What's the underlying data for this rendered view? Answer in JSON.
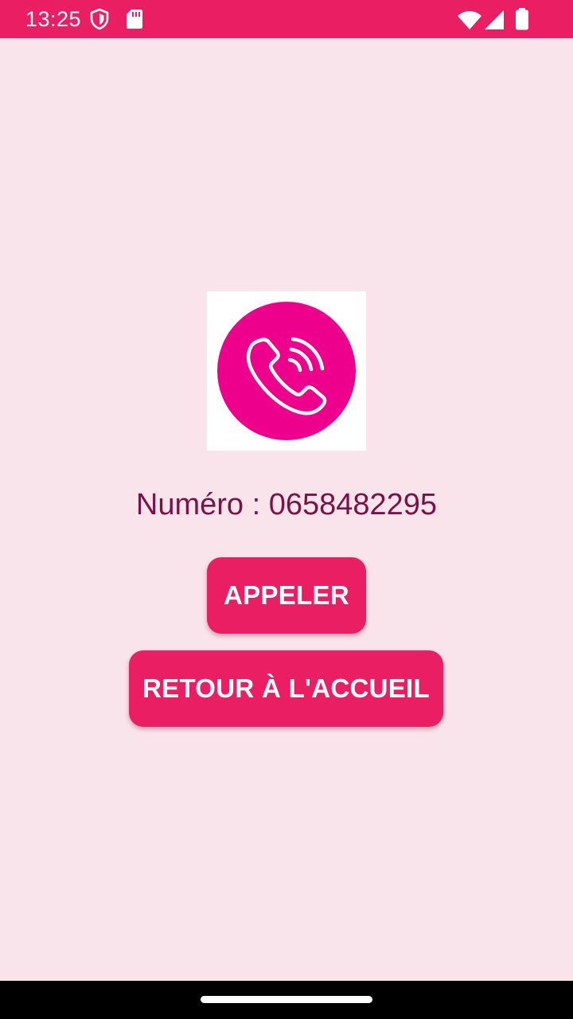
{
  "status_bar": {
    "time": "13:25",
    "color": "#e91e63",
    "icons": [
      "shield-icon",
      "sd-card-icon",
      "wifi-icon",
      "cell-signal-icon",
      "battery-icon"
    ]
  },
  "main": {
    "logo_icon": "phone-call-icon",
    "logo_color": "#ec008c",
    "number_label": "Numéro : 0658482295",
    "call_button_label": "APPELER",
    "home_button_label": "RETOUR À L'ACCUEIL",
    "button_color": "#e91e63",
    "background_color": "#fae4eb"
  },
  "nav_bar": {
    "home_handle": "gesture-handle"
  }
}
